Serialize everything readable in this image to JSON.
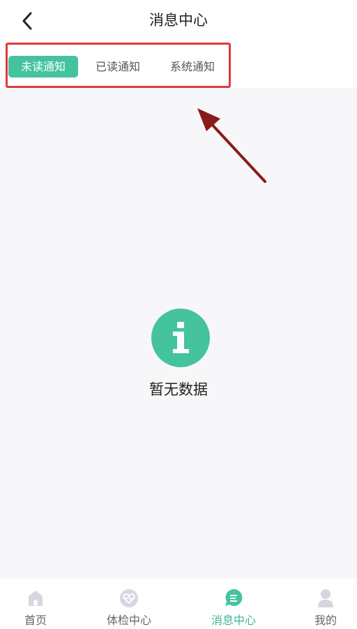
{
  "header": {
    "title": "消息中心",
    "back_icon": "chevron-left-icon"
  },
  "tabs": [
    {
      "label": "未读通知",
      "active": true
    },
    {
      "label": "已读通知",
      "active": false
    },
    {
      "label": "系统通知",
      "active": false
    }
  ],
  "empty_state": {
    "icon": "info-icon",
    "text": "暂无数据"
  },
  "tabbar": {
    "items": [
      {
        "label": "首页",
        "icon": "home-icon",
        "active": false
      },
      {
        "label": "体检中心",
        "icon": "heart-icon",
        "active": false
      },
      {
        "label": "消息中心",
        "icon": "message-icon",
        "active": true
      },
      {
        "label": "我的",
        "icon": "user-icon",
        "active": false
      }
    ]
  },
  "colors": {
    "accent": "#44c39e",
    "highlight_box": "#e0393e",
    "annotation_arrow": "#8b1a1a",
    "background": "#f7f7f9"
  }
}
